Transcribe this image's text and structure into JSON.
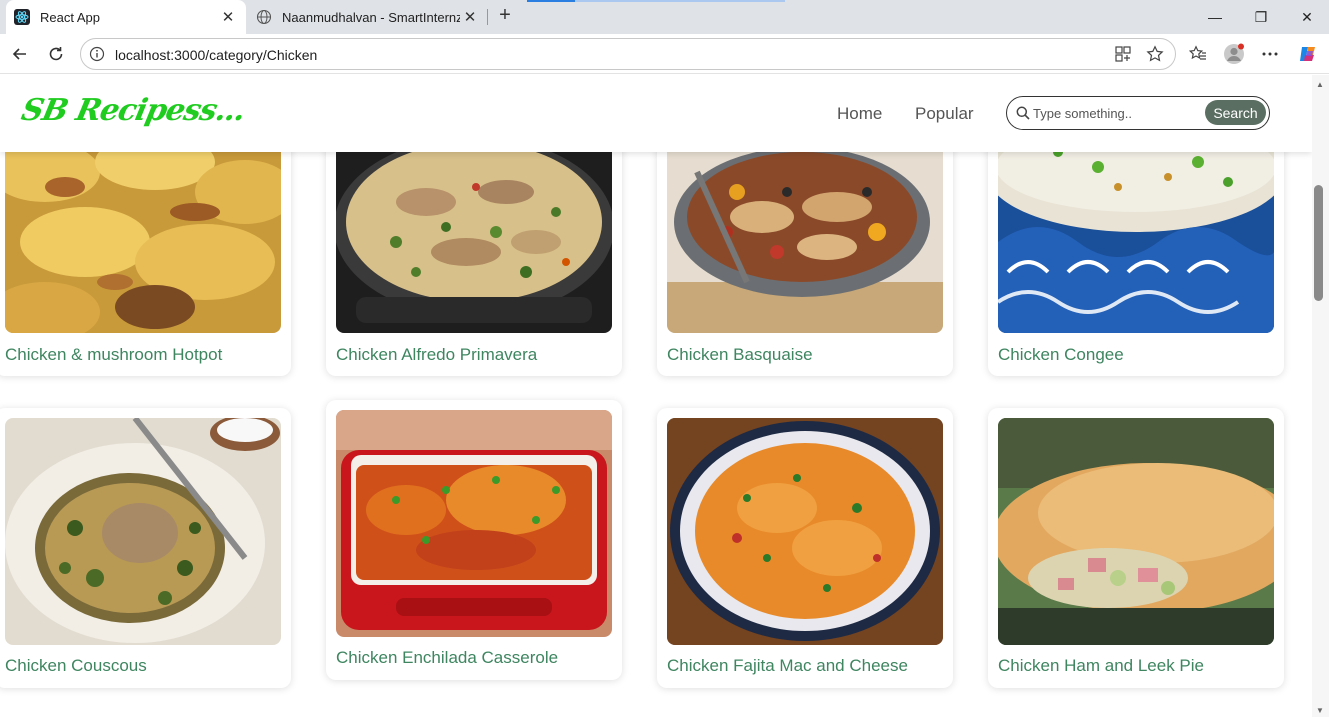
{
  "browser": {
    "tabs": [
      {
        "title": "React App",
        "active": true
      },
      {
        "title": "Naanmudhalvan - SmartInternz",
        "active": false
      }
    ],
    "url": "localhost:3000/category/Chicken"
  },
  "header": {
    "logo": "SB Recipess...",
    "nav": [
      "Home",
      "Popular"
    ],
    "search": {
      "placeholder": "Type something..",
      "button": "Search"
    }
  },
  "recipes": [
    {
      "name": "Chicken & mushroom Hotpot"
    },
    {
      "name": "Chicken Alfredo Primavera"
    },
    {
      "name": "Chicken Basquaise"
    },
    {
      "name": "Chicken Congee"
    },
    {
      "name": "Chicken Couscous"
    },
    {
      "name": "Chicken Enchilada Casserole"
    },
    {
      "name": "Chicken Fajita Mac and Cheese"
    },
    {
      "name": "Chicken Ham and Leek Pie"
    }
  ],
  "colors": {
    "logo": "#1fcc1f",
    "recipe_text": "#3e8560",
    "search_button": "#5b6e62"
  }
}
